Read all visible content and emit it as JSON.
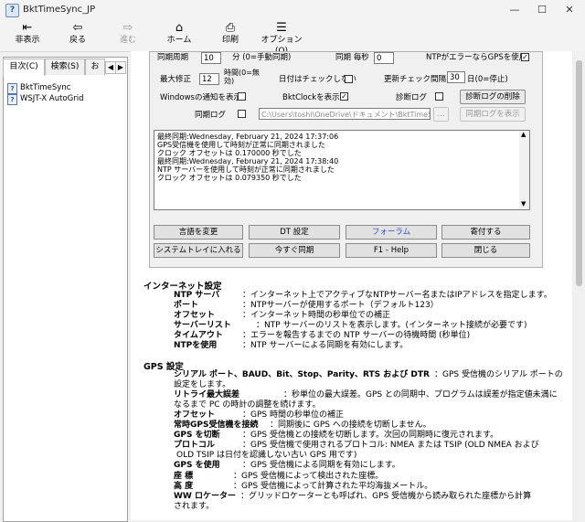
{
  "window": {
    "title": "BktTimeSync_JP",
    "minimize": "—",
    "maximize": "☐",
    "close": "✕"
  },
  "toolbar": {
    "hide": "非表示",
    "back": "戻る",
    "forward": "進む",
    "home": "ホーム",
    "print": "印刷",
    "options": "オプション(O)",
    "icons": {
      "hide": "⇤",
      "back": "⇦",
      "forward": "⇨",
      "home": "⌂",
      "print": "⎙",
      "options": "☰"
    }
  },
  "sidebar": {
    "tabs": [
      "目次(C)",
      "検索(S)",
      "お"
    ],
    "items": [
      "BktTimeSync",
      "WSJT-X AutoGrid"
    ]
  },
  "settings": {
    "sync_period_label": "同期周期",
    "sync_period_value": "10",
    "sync_period_unit": "分 (0=手動同期)",
    "sync_every_sec_label": "同期 毎秒",
    "sync_every_sec_value": "0",
    "ntp_gps_label": "NTPがエラーならGPSを使用",
    "ntp_gps_checked": "✓",
    "max_correct_label": "最大修正",
    "max_correct_value": "12",
    "max_correct_unit1": "時間(0=無",
    "max_correct_unit2": "効)",
    "date_nocheck_label": "日付はチェックしない",
    "update_check_label": "更新チェック間隔",
    "update_check_value": "30",
    "update_check_unit": "日(0=停止)",
    "win_notify_label": "Windowsの通知を表示",
    "bktclock_label": "BktClockを表示",
    "bktclock_checked": "✓",
    "diag_log_label": "診断ログ",
    "diag_log_delete": "診断ログの削除",
    "sync_log_label": "同期ログ",
    "log_path": "C:\\Users\\toshi\\OneDrive\\ドキュメント\\BktTimeSyncL",
    "browse": "...",
    "show_sync_log": "同期ログを表示"
  },
  "log_lines": [
    "最終同期:Wednesday, February 21, 2024 17:37:06",
    "GPS受信機を使用して時刻が正常に同期されました",
    "クロック オフセットは 0.170000 秒でした",
    "最終同期:Wednesday, February 21, 2024 17:38:40",
    "NTP サーバーを使用して時刻が正常に同期されました",
    "クロック オフセットは 0.079350 秒でした"
  ],
  "buttons": {
    "change_lang": "言語を変更",
    "dt_settings": "DT 設定",
    "forum": "フォーラム",
    "donate": "寄付する",
    "tray": "システムトレイに入れる",
    "sync_now": "今すぐ同期",
    "help": "F1 - Help",
    "close": "閉じる"
  },
  "help": {
    "internet_heading": "インターネット設定",
    "internet_rows": [
      {
        "term": "NTP サーバ",
        "desc": "：インターネット上でアクティブなNTPサーバー名またはIPアドレスを指定します。"
      },
      {
        "term": "ポート",
        "desc": "：NTPサーバーが使用するポート（デフォルト123）"
      },
      {
        "term": "オフセット",
        "desc": "：インターネット時間の秒単位での補正"
      },
      {
        "term": "サーバーリスト",
        "desc": "：NTP サーバーのリストを表示します。(インターネット接続が必要です)"
      },
      {
        "term": "タイムアウト",
        "desc": "：エラーを報告するまでの NTP サーバーの待機時間 (秒単位)"
      },
      {
        "term": "NTPを使用",
        "desc": "：NTP サーバーによる同期を有効にします。"
      }
    ],
    "gps_heading": "GPS 設定",
    "gps_rows": [
      {
        "term": "シリアル ポート、BAUD、Bit、Stop、Parity、RTS および DTR",
        "desc": "：GPS 受信機のシリアル ポートの"
      },
      {
        "term": "",
        "desc": "設定をします。"
      },
      {
        "term": "リトライ最大誤差",
        "desc": "：秒単位の最大誤差。GPS との同期中、プログラムは誤差が指定値未満に"
      },
      {
        "term": "",
        "desc": "なるまで PC の時計の調整を続けます。"
      },
      {
        "term": "オフセット",
        "desc": "：GPS 時間の秒単位の補正"
      },
      {
        "term": "常時GPS受信機を接続",
        "desc": "：同期後に GPS への接続を切断しません。"
      },
      {
        "term": "GPS を切断",
        "desc": "：GPS 受信機との接続を切断します。次回の同期時に復元されます。"
      },
      {
        "term": "プロトコル",
        "desc": "：GPS 受信機で使用されるプロトコル: NMEA または TSIP (OLD NMEA および"
      },
      {
        "term": "",
        "desc": "OLD TSIP は日付を認識しない古い GPS 用です)"
      },
      {
        "term": "GPS を使用",
        "desc": "：GPS 受信機による同期を有効にします。"
      },
      {
        "term": "座 標",
        "desc": "：GPS 受信機によって検出された座標。"
      },
      {
        "term": "高 度",
        "desc": "：GPS 受信機によって計算された平均海抜メートル。"
      },
      {
        "term": "WW ロケーター",
        "desc": "：グリッドロケーターとも呼ばれ、GPS 受信機から読み取られた座標から計算"
      },
      {
        "term": "",
        "desc": "されます。"
      }
    ]
  }
}
